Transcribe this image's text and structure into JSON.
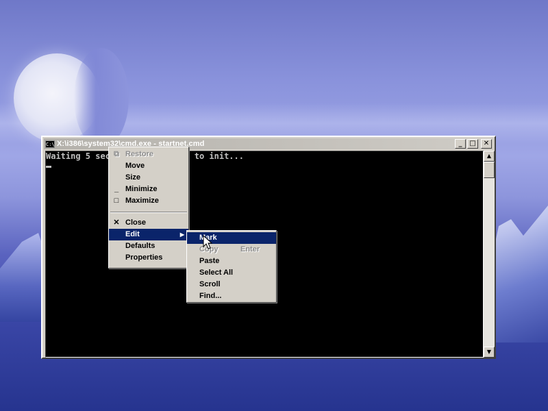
{
  "window": {
    "title": "X:\\i386\\system32\\cmd.exe - startnet.cmd",
    "icon_text": "C:\\",
    "buttons": {
      "minimize": "_",
      "maximize": "□",
      "close": "✕"
    }
  },
  "console": {
    "line1": "Waiting 5 seconds for network to init..."
  },
  "system_menu": {
    "items": [
      {
        "label": "Restore",
        "glyph": "⧉",
        "disabled": true
      },
      {
        "label": "Move"
      },
      {
        "label": "Size"
      },
      {
        "label": "Minimize",
        "glyph": "_"
      },
      {
        "label": "Maximize",
        "glyph": "□"
      },
      {
        "label": "Close",
        "glyph": "✕"
      },
      {
        "label": "Edit",
        "arrow": "▶",
        "highlighted": true
      },
      {
        "label": "Defaults"
      },
      {
        "label": "Properties"
      }
    ]
  },
  "edit_menu": {
    "items": [
      {
        "label": "Mark",
        "highlighted": true
      },
      {
        "label": "Copy",
        "shortcut": "Enter",
        "disabled": true
      },
      {
        "label": "Paste"
      },
      {
        "label": "Select All"
      },
      {
        "label": "Scroll"
      },
      {
        "label": "Find..."
      }
    ]
  },
  "colors": {
    "menu_highlight": "#0a246a",
    "console_bg": "#000000",
    "console_text": "#c0c0c0"
  }
}
